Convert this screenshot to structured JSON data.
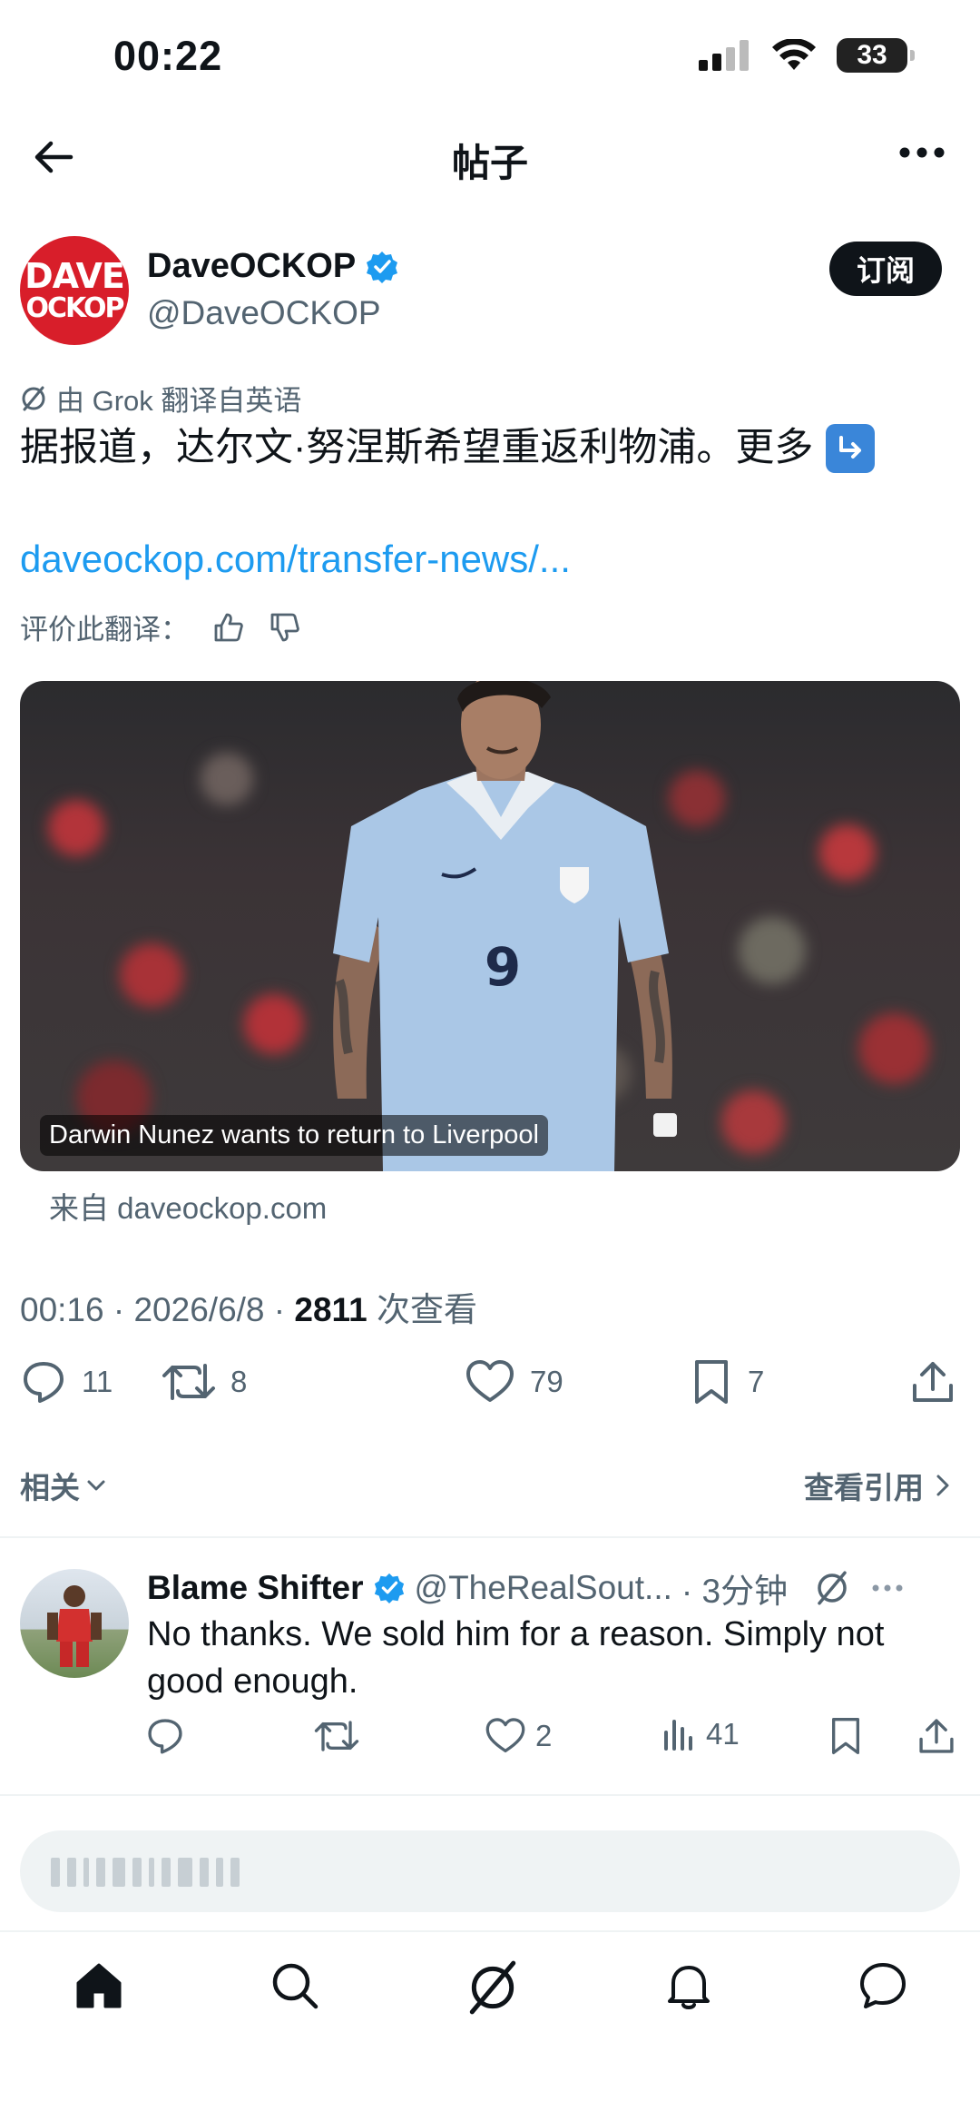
{
  "status_bar": {
    "time": "00:22",
    "battery": "33"
  },
  "header": {
    "title": "帖子"
  },
  "author": {
    "avatar_line1": "DAVE",
    "avatar_line2": "OCKOP",
    "name": "DaveOCKOP",
    "handle": "@DaveOCKOP",
    "subscribe": "订阅"
  },
  "tweet": {
    "translation_note": "由 Grok 翻译自英语",
    "text": "据报道，达尔文·努涅斯希望重返利物浦。更多",
    "link": "daveockop.com/transfer-news/...",
    "rate_translation": "评价此翻译：",
    "media_caption": "Darwin Nunez wants to return to Liverpool",
    "media_source": "来自 daveockop.com",
    "time": "00:16",
    "date": "2026/6/8",
    "views": "2811",
    "views_label": "次查看"
  },
  "actions": {
    "replies": "11",
    "reposts": "8",
    "likes": "79",
    "bookmarks": "7"
  },
  "links": {
    "related": "相关",
    "view_quotes": "查看引用"
  },
  "reply": {
    "name": "Blame Shifter",
    "handle": "@TheRealSout...",
    "time": "· 3分钟",
    "text": "No thanks. We sold him for a reason. Simply not good enough.",
    "likes": "2",
    "views": "41"
  },
  "colors": {
    "accent": "#1d9bf0",
    "text": "#0f1419",
    "muted": "#536471",
    "brand_red": "#d81e2a"
  }
}
